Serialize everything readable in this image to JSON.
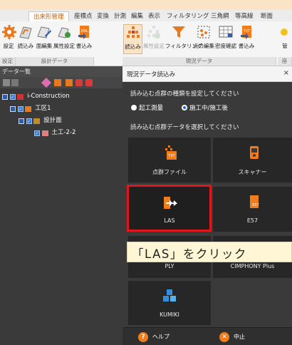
{
  "ribbon": {
    "tabs": [
      "出来形管理",
      "座標点",
      "変換",
      "計測",
      "編集",
      "表示",
      "フィルタリング",
      "三角網",
      "等高線",
      "断面"
    ],
    "active_tab": "出来形管理",
    "buttons": [
      {
        "label": "設定"
      },
      {
        "label": "読込み"
      },
      {
        "label": "面編集"
      },
      {
        "label": "属性設定"
      },
      {
        "label": "書込み"
      },
      {
        "label": "読込み"
      },
      {
        "label": "属性設定"
      },
      {
        "label": "フィルタリング"
      },
      {
        "label": "点の編集"
      },
      {
        "label": "密度確認"
      },
      {
        "label": "書込み"
      },
      {
        "label": "管"
      }
    ],
    "groups": [
      "設定",
      "設計データ",
      "現況データ",
      "座"
    ]
  },
  "left_panel": {
    "title": "データ一覧",
    "tree": [
      {
        "label": "i-Construction"
      },
      {
        "label": "工区1"
      },
      {
        "label": "設計面"
      },
      {
        "label": "土工-2-2"
      }
    ]
  },
  "dialog": {
    "title": "現況データ読込み",
    "close": "×",
    "kind_label": "読み込む点群の種類を設定してください",
    "radios": [
      {
        "label": "起工測量",
        "selected": false
      },
      {
        "label": "施工中/施工後",
        "selected": true
      }
    ],
    "select_label": "読み込む点群データを選択してください",
    "tiles": [
      {
        "label": "点群ファイル",
        "badge": "TXT"
      },
      {
        "label": "スキャナー"
      },
      {
        "label": "LAS"
      },
      {
        "label": "E57",
        "badge": "E57"
      },
      {
        "label": "PLY"
      },
      {
        "label": "CIMPHONY Plus"
      },
      {
        "label": "KUMIKI"
      }
    ],
    "footer": {
      "help": "ヘルプ",
      "cancel": "中止"
    }
  },
  "callout": {
    "text": "「LAS」をクリック"
  },
  "colors": {
    "highlight": "#e0161f",
    "accent_orange": "#f07c1c",
    "selected_blue": "#1a66d8",
    "panel_dark": "#3a3a3a"
  }
}
